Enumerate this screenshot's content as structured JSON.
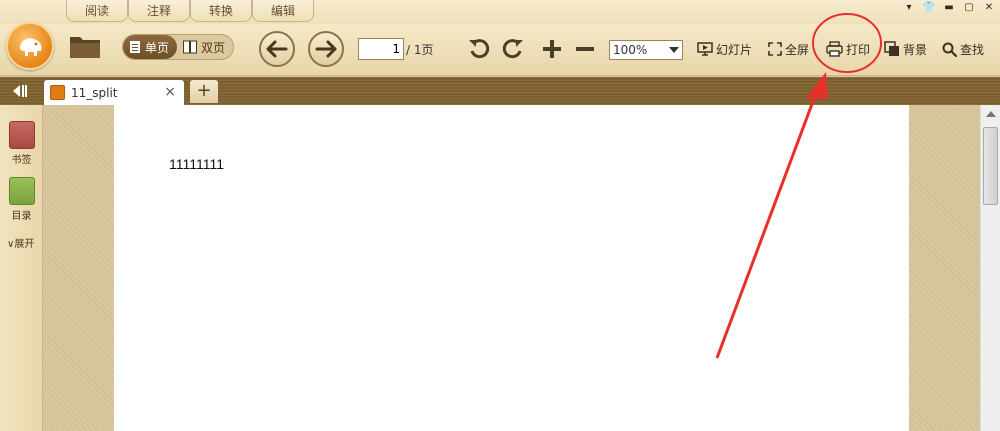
{
  "menu": {
    "tabs": [
      "阅读",
      "注释",
      "转换",
      "编辑"
    ]
  },
  "window_controls": {
    "dropdown": "▾",
    "skin": "👕",
    "minimize": "▬",
    "maximize": "▢",
    "close": "✕"
  },
  "toolbar": {
    "single_page": "单页",
    "double_page": "双页",
    "page_current": "1",
    "page_total": "/ 1页",
    "zoom": "100%",
    "slideshow": "幻灯片",
    "fullscreen": "全屏",
    "print": "打印",
    "background": "背景",
    "search": "查找"
  },
  "document_tabs": {
    "active_tab": "11_split",
    "close": "×",
    "add": "+"
  },
  "sidebar": {
    "bookmark": "书签",
    "toc": "目录",
    "expand": "展开"
  },
  "document": {
    "text": "11111111"
  },
  "colors": {
    "annotation": "#e8302a",
    "accent": "#e58519"
  }
}
